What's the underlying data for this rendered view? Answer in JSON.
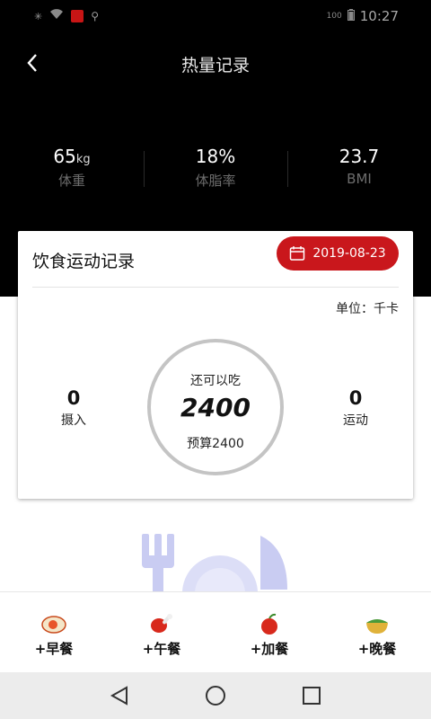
{
  "status_bar": {
    "time": "10:27",
    "battery": "100"
  },
  "header": {
    "title": "热量记录"
  },
  "stats": [
    {
      "value": "65",
      "unit": "kg",
      "label": "体重"
    },
    {
      "value": "18%",
      "unit": "",
      "label": "体脂率"
    },
    {
      "value": "23.7",
      "unit": "",
      "label": "BMI"
    }
  ],
  "card": {
    "title": "饮食运动记录",
    "date": "2019-08-23",
    "unit_label": "单位：千卡",
    "intake": {
      "value": "0",
      "label": "摄入"
    },
    "exercise": {
      "value": "0",
      "label": "运动"
    },
    "remaining": {
      "caption": "还可以吃",
      "value": "2400",
      "budget": "预算2400"
    }
  },
  "meals": [
    {
      "label": "+早餐",
      "icon": "fried-egg-icon"
    },
    {
      "label": "+午餐",
      "icon": "chicken-leg-icon"
    },
    {
      "label": "+加餐",
      "icon": "apple-icon"
    },
    {
      "label": "+晚餐",
      "icon": "noodle-bowl-icon"
    }
  ],
  "colors": {
    "accent": "#c9171c",
    "header_bg": "#000000",
    "illustration": "#c9ccf2"
  }
}
